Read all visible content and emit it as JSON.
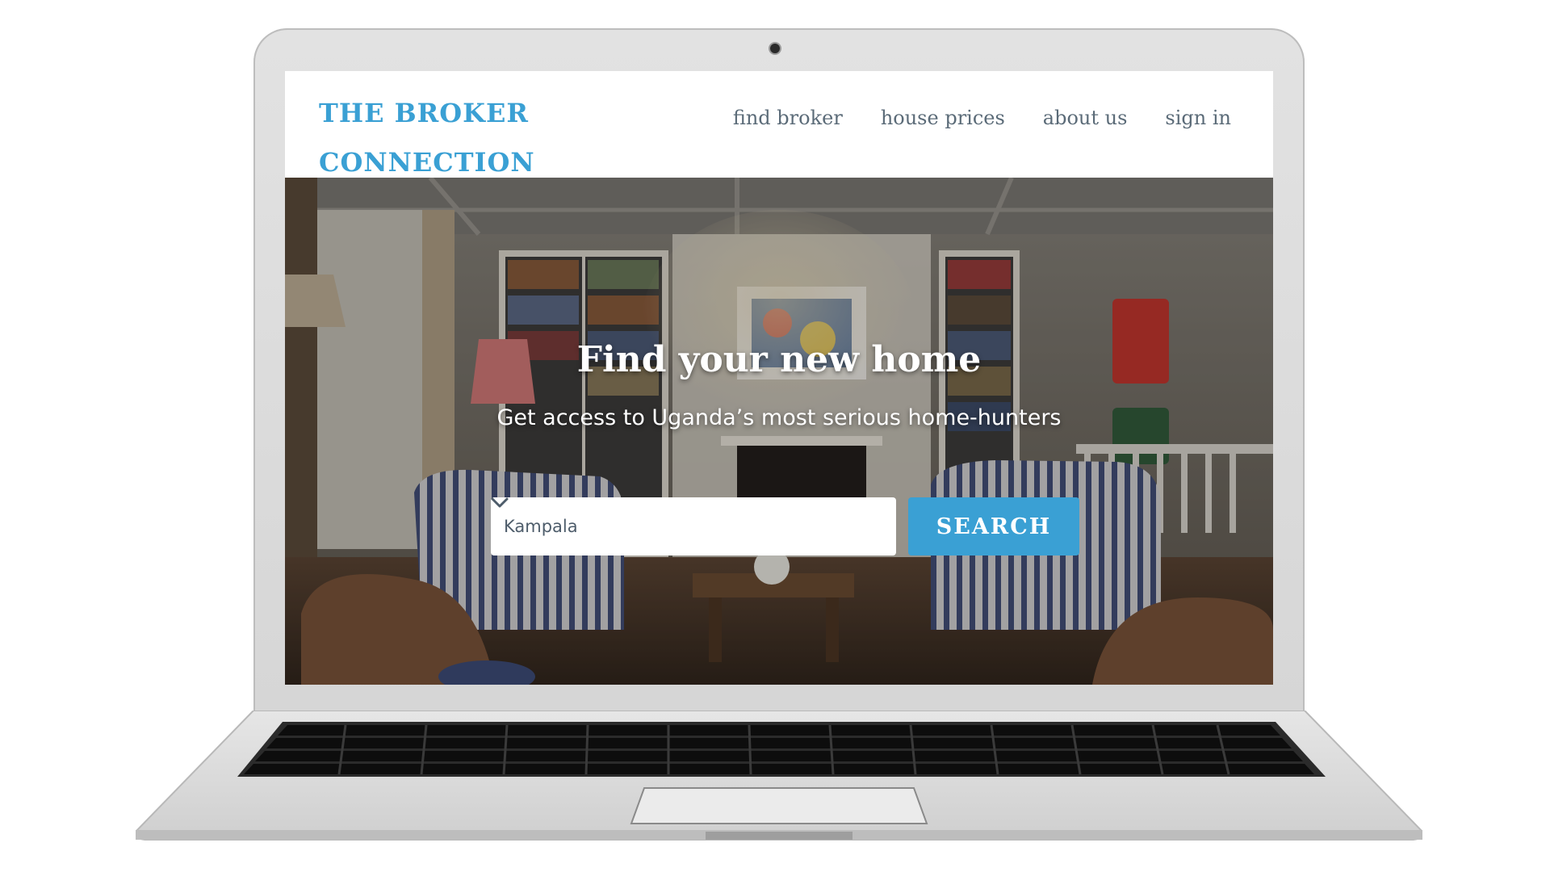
{
  "site": {
    "logo_line1": "THE BROKER",
    "logo_line2": "CONNECTION"
  },
  "nav": {
    "items": [
      {
        "label": "find broker"
      },
      {
        "label": "house prices"
      },
      {
        "label": "about us"
      },
      {
        "label": "sign in"
      }
    ]
  },
  "hero": {
    "title": "Find your new home",
    "subtitle": "Get access to Uganda’s most serious home-hunters"
  },
  "search": {
    "location_value": "Kampala",
    "button_label": "SEARCH",
    "dropdown_icon": "chevron-down-icon"
  },
  "colors": {
    "brand": "#3aa0d4",
    "nav_text": "#5b6b78",
    "select_text": "#4e5d6b"
  }
}
